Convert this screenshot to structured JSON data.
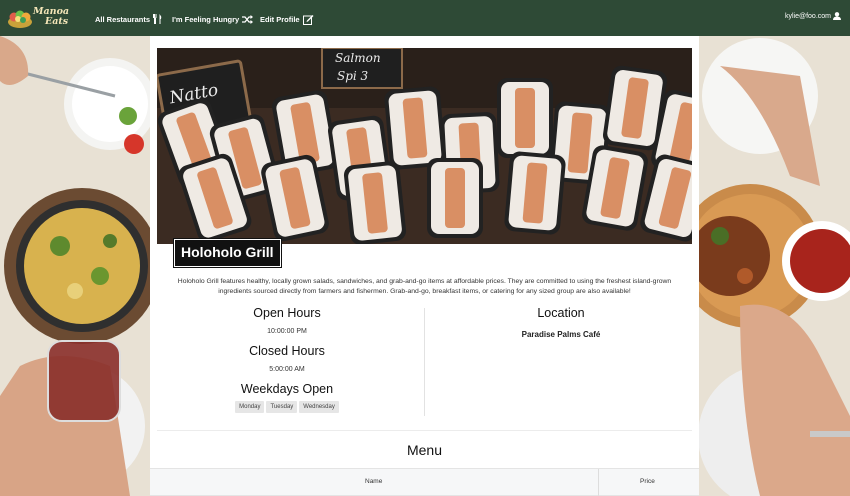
{
  "brand": {
    "logo_line1": "Manoa",
    "logo_line2": "Eats"
  },
  "nav": {
    "all_restaurants": "All Restaurants",
    "feeling_hungry": "I'm Feeling Hungry",
    "edit_profile": "Edit Profile",
    "user_email": "kylie@foo.com"
  },
  "restaurant": {
    "name": "Holoholo Grill",
    "description": "Holoholo Grill features healthy, locally grown salads, sandwiches, and grab-and-go items at affordable prices. They are committed to using the freshest island-grown ingredients sourced directly from farmers and fishermen. Grab-and-go, breakfast items, or catering for any sized group are also available!",
    "hero_signs": [
      "Natto",
      "Salmon",
      "Spi 3"
    ]
  },
  "hours": {
    "open_heading": "Open Hours",
    "open_value": "10:00:00 PM",
    "closed_heading": "Closed Hours",
    "closed_value": "5:00:00 AM",
    "weekdays_heading": "Weekdays Open",
    "weekdays": [
      "Monday",
      "Tuesday",
      "Wednesday"
    ]
  },
  "location": {
    "heading": "Location",
    "value": "Paradise Palms Café"
  },
  "menu": {
    "title": "Menu",
    "col_name": "Name",
    "col_price": "Price"
  },
  "colors": {
    "navbar": "#2e4a36",
    "logo_text": "#f4e6b8",
    "badge_bg": "#111111"
  }
}
